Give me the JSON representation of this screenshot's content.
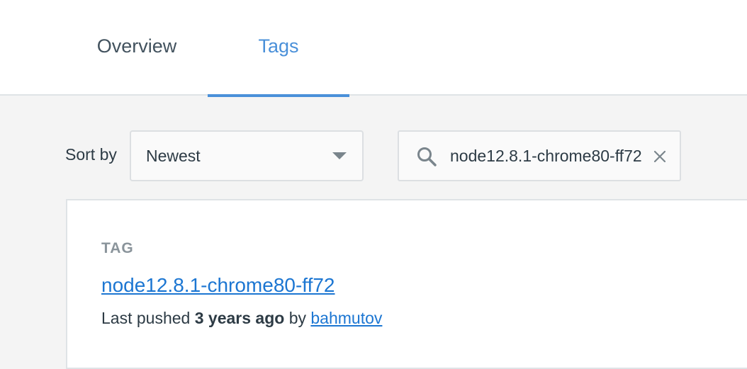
{
  "tabs": [
    {
      "label": "Overview",
      "active": false
    },
    {
      "label": "Tags",
      "active": true
    }
  ],
  "sort": {
    "label": "Sort by",
    "selected": "Newest"
  },
  "search": {
    "value": "node12.8.1-chrome80-ff72",
    "icon": "search-icon",
    "clear_icon": "close-icon"
  },
  "tag_card": {
    "section_label": "TAG",
    "tag_name": "node12.8.1-chrome80-ff72",
    "pushed_prefix": "Last pushed ",
    "pushed_time": "3 years ago",
    "pushed_by": " by ",
    "user": "bahmutov"
  },
  "colors": {
    "accent": "#4a90d9",
    "link": "#1c76d2",
    "background": "#f4f4f4"
  }
}
